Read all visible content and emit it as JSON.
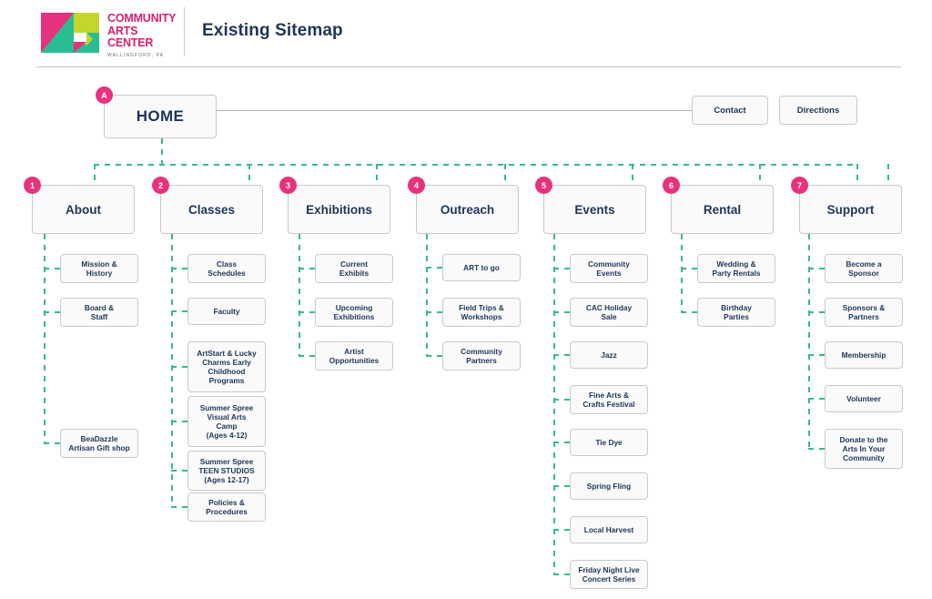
{
  "header": {
    "logo_line1": "COMMUNITY",
    "logo_line2": "ARTS CENTER",
    "logo_sub": "WALLINGFORD, PA",
    "title": "Existing Sitemap",
    "logo_colors": {
      "pink": "#e6327e",
      "teal": "#2bbd92",
      "lime": "#c3d62e",
      "white": "#ffffff"
    }
  },
  "colors": {
    "accent_pink": "#e6327e",
    "connector_green": "#33bb93",
    "node_border": "#c9c9c9",
    "node_fill": "#fafafa",
    "text_navy": "#1d3557",
    "solid_line": "#b3b3b3"
  },
  "root": {
    "badge": "A",
    "label": "HOME"
  },
  "utility_nodes": [
    {
      "label": "Contact"
    },
    {
      "label": "Directions"
    }
  ],
  "sections": [
    {
      "badge": "1",
      "label": "About",
      "children": [
        {
          "label": "Mission &\nHistory",
          "lines": [
            "Mission &",
            "History"
          ]
        },
        {
          "label": "Board &\nStaff",
          "lines": [
            "Board &",
            "Staff"
          ]
        },
        {
          "label": "BeaDazzle\nArtisan Gift shop",
          "lines": [
            "BeaDazzle",
            "Artisan Gift shop"
          ],
          "gap_before": 2
        }
      ]
    },
    {
      "badge": "2",
      "label": "Classes",
      "children": [
        {
          "label": "Class\nSchedules",
          "lines": [
            "Class",
            "Schedules"
          ]
        },
        {
          "label": "Faculty",
          "lines": [
            "Faculty"
          ]
        },
        {
          "label": "ArtStart & Lucky Charms Early Childhood Programs",
          "lines": [
            "ArtStart & Lucky",
            "Charms Early",
            "Childhood",
            "Programs"
          ]
        },
        {
          "label": "Summer Spree Visual Arts Camp (Ages 4-12)",
          "lines": [
            "Summer Spree",
            "Visual Arts",
            "Camp",
            "(Ages 4-12)"
          ]
        },
        {
          "label": "Summer Spree TEEN STUDIOS (Ages 12-17)",
          "lines": [
            "Summer Spree",
            "TEEN STUDIOS",
            "(Ages 12-17)"
          ]
        },
        {
          "label": "Policies &\nProcedures",
          "lines": [
            "Policies &",
            "Procedures"
          ]
        }
      ]
    },
    {
      "badge": "3",
      "label": "Exhibitions",
      "children": [
        {
          "label": "Current\nExhibits",
          "lines": [
            "Current",
            "Exhibits"
          ]
        },
        {
          "label": "Upcoming\nExhibitions",
          "lines": [
            "Upcoming",
            "Exhibitions"
          ]
        },
        {
          "label": "Artist\nOpportunities",
          "lines": [
            "Artist",
            "Opportunities"
          ]
        }
      ]
    },
    {
      "badge": "4",
      "label": "Outreach",
      "children": [
        {
          "label": "ART to go",
          "lines": [
            "ART to go"
          ]
        },
        {
          "label": "Field Trips &\nWorkshops",
          "lines": [
            "Field Trips &",
            "Workshops"
          ]
        },
        {
          "label": "Community\nPartners",
          "lines": [
            "Community",
            "Partners"
          ]
        }
      ]
    },
    {
      "badge": "5",
      "label": "Events",
      "children": [
        {
          "label": "Community\nEvents",
          "lines": [
            "Community",
            "Events"
          ]
        },
        {
          "label": "CAC Holiday\nSale",
          "lines": [
            "CAC Holiday",
            "Sale"
          ]
        },
        {
          "label": "Jazz",
          "lines": [
            "Jazz"
          ]
        },
        {
          "label": "Fine Arts &\nCrafts Festival",
          "lines": [
            "Fine Arts &",
            "Crafts Festival"
          ]
        },
        {
          "label": "Tie Dye",
          "lines": [
            "Tie Dye"
          ]
        },
        {
          "label": "Spring Fling",
          "lines": [
            "Spring Fling"
          ]
        },
        {
          "label": "Local Harvest",
          "lines": [
            "Local Harvest"
          ]
        },
        {
          "label": "Friday Night Live\nConcert Series",
          "lines": [
            "Friday Night Live",
            "Concert Series"
          ]
        }
      ]
    },
    {
      "badge": "6",
      "label": "Rental",
      "children": [
        {
          "label": "Wedding &\nParty Rentals",
          "lines": [
            "Wedding &",
            "Party Rentals"
          ]
        },
        {
          "label": "Birthday\nParties",
          "lines": [
            "Birthday",
            "Parties"
          ]
        }
      ]
    },
    {
      "badge": "7",
      "label": "Support",
      "children": [
        {
          "label": "Become a\nSponsor",
          "lines": [
            "Become a",
            "Sponsor"
          ]
        },
        {
          "label": "Sponsors &\nPartners",
          "lines": [
            "Sponsors &",
            "Partners"
          ]
        },
        {
          "label": "Membership",
          "lines": [
            "Membership"
          ]
        },
        {
          "label": "Volunteer",
          "lines": [
            "Volunteer"
          ]
        },
        {
          "label": "Donate to the Arts In Your Community",
          "lines": [
            "Donate to the",
            "Arts In Your",
            "Community"
          ]
        }
      ]
    }
  ]
}
